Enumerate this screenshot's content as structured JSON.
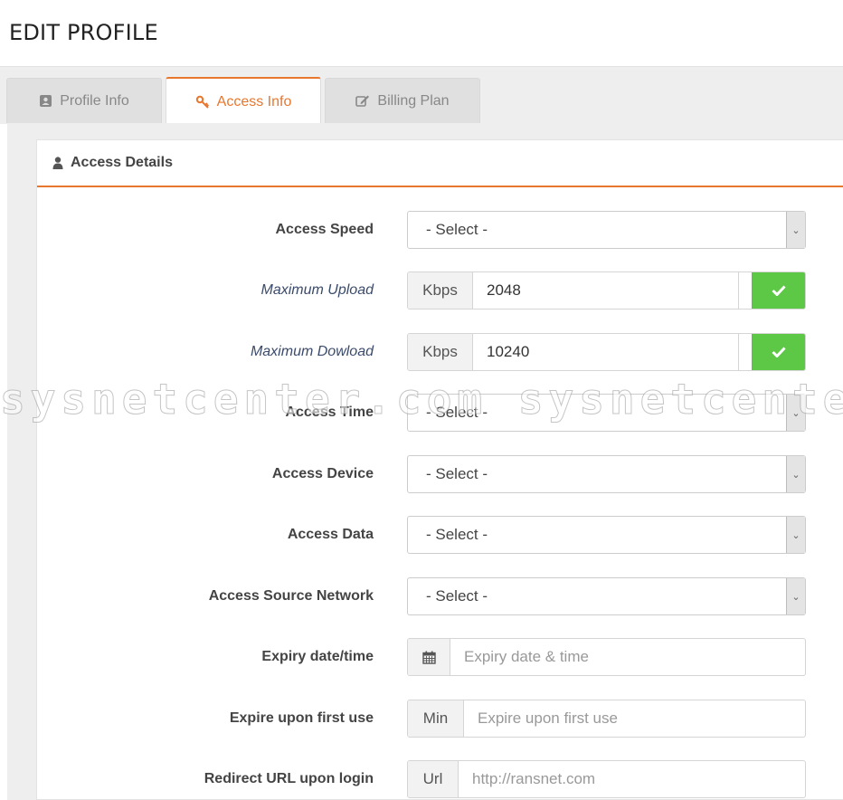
{
  "page_title": "EDIT PROFILE",
  "tabs": [
    {
      "label": "Profile Info",
      "icon": "contact-card-icon",
      "active": false
    },
    {
      "label": "Access Info",
      "icon": "key-icon",
      "active": true
    },
    {
      "label": "Billing Plan",
      "icon": "edit-icon",
      "active": false
    }
  ],
  "panel": {
    "title": "Access Details",
    "icon": "user-icon"
  },
  "form": {
    "access_speed": {
      "label": "Access Speed",
      "value": "- Select -"
    },
    "max_upload": {
      "label": "Maximum Upload",
      "unit": "Kbps",
      "value": "2048",
      "enabled": true
    },
    "max_download": {
      "label": "Maximum Dowload",
      "unit": "Kbps",
      "value": "10240",
      "enabled": true
    },
    "access_time": {
      "label": "Access Time",
      "value": "- Select -"
    },
    "access_device": {
      "label": "Access Device",
      "value": "- Select -"
    },
    "access_data": {
      "label": "Access Data",
      "value": "- Select -"
    },
    "access_source_network": {
      "label": "Access Source Network",
      "value": "- Select -"
    },
    "expiry": {
      "label": "Expiry date/time",
      "icon": "calendar-icon",
      "placeholder": "Expiry date & time"
    },
    "expire_first_use": {
      "label": "Expire upon first use",
      "unit": "Min",
      "placeholder": "Expire upon first use"
    },
    "redirect_url": {
      "label": "Redirect URL upon login",
      "unit": "Url",
      "placeholder": "http://ransnet.com"
    }
  },
  "watermark": "sysnetcenter.com sysnetcenter.",
  "colors": {
    "accent": "#e8772e",
    "toggle_on": "#5cc845"
  }
}
